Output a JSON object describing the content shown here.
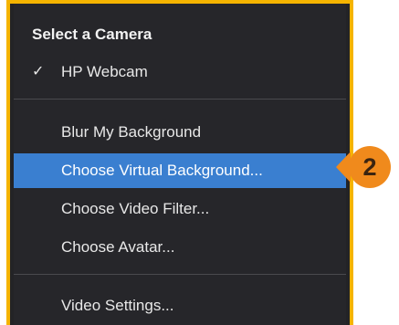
{
  "menu": {
    "header": "Select a Camera",
    "camera_items": [
      {
        "label": "HP Webcam",
        "checked": true,
        "check_glyph": "✓"
      }
    ],
    "background_items": [
      {
        "label": "Blur My Background"
      },
      {
        "label": "Choose Virtual Background...",
        "selected": true
      },
      {
        "label": "Choose Video Filter..."
      },
      {
        "label": "Choose Avatar..."
      }
    ],
    "settings_items": [
      {
        "label": "Video Settings..."
      }
    ]
  },
  "callout": {
    "step_number": "2"
  },
  "colors": {
    "highlight_frame": "#f5b400",
    "menu_background": "#26262a",
    "selected_item": "#3a7fd0",
    "badge": "#f08a1c"
  }
}
